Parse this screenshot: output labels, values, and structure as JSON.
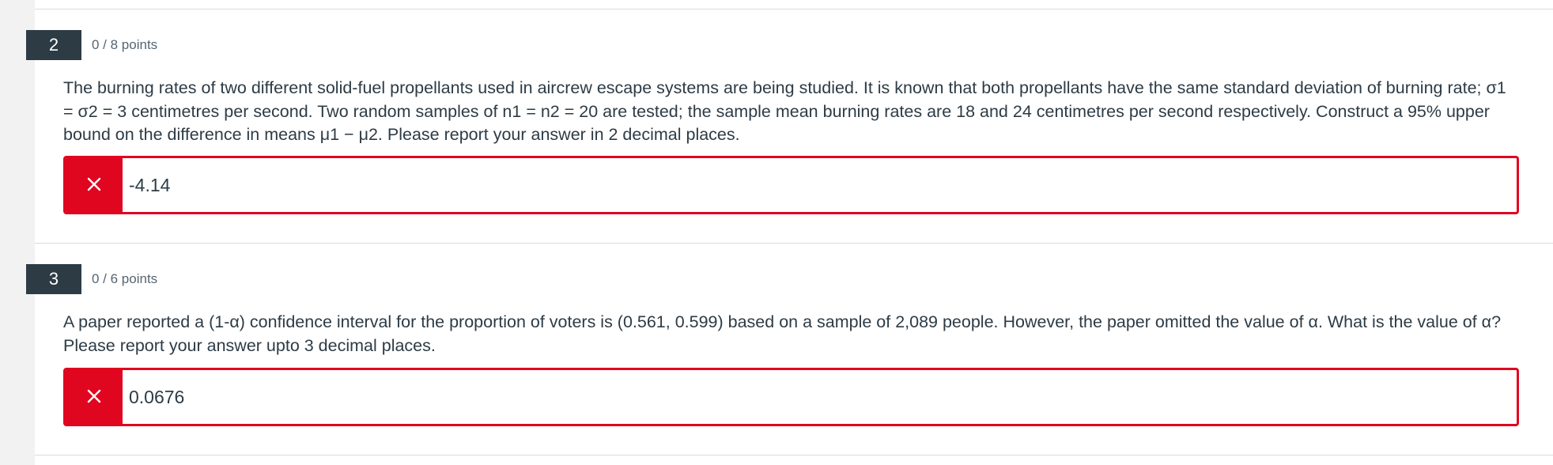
{
  "questions": [
    {
      "number": "2",
      "points": "0 / 8 points",
      "text": "The burning rates of two different solid-fuel propellants used in aircrew escape systems are being studied. It is known that both propellants have the same standard deviation of burning rate; σ1 = σ2 = 3 centimetres per second. Two random samples of n1 = n2 = 20 are tested; the sample mean burning rates are 18 and 24 centimetres per second respectively. Construct a 95% upper bound on the difference in means μ1 − μ2. Please report your answer in 2 decimal places.",
      "answer": "-4.14",
      "status_icon": "x-icon"
    },
    {
      "number": "3",
      "points": "0 / 6 points",
      "text": "A paper reported a (1-α) confidence interval for the proportion of voters is (0.561, 0.599) based on a sample of 2,089 people. However, the paper omitted the value of α. What is the value of α? Please report your answer upto 3 decimal places.",
      "answer": "0.0676",
      "status_icon": "x-icon"
    }
  ],
  "colors": {
    "incorrect": "#e0061f",
    "number_badge": "#2d3b45",
    "text": "#2d3b45",
    "muted_text": "#556572",
    "background": "#f2f2f2"
  }
}
